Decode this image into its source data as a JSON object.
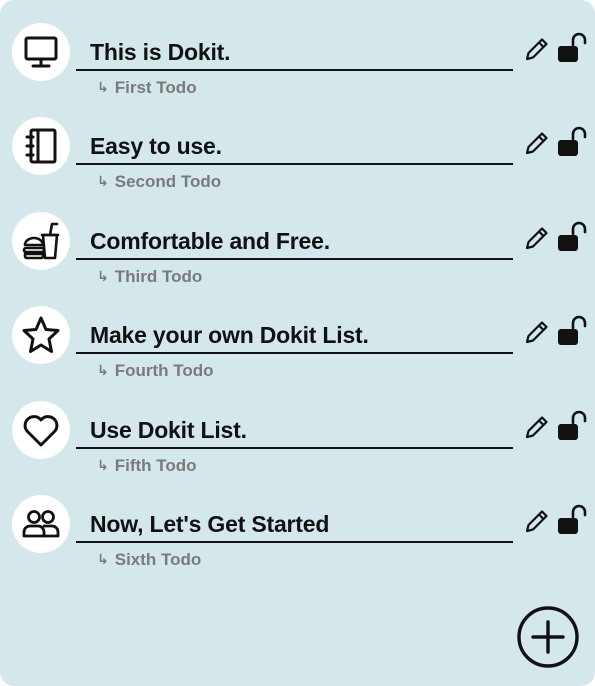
{
  "todos": [
    {
      "icon": "monitor-icon",
      "title": "This is Dokit.",
      "subtitle": "First Todo"
    },
    {
      "icon": "notebook-icon",
      "title": "Easy to use.",
      "subtitle": "Second Todo"
    },
    {
      "icon": "fast-food-icon",
      "title": "Comfortable and Free.",
      "subtitle": "Third Todo"
    },
    {
      "icon": "star-icon",
      "title": "Make your own Dokit List.",
      "subtitle": "Fourth Todo"
    },
    {
      "icon": "heart-icon",
      "title": "Use Dokit List.",
      "subtitle": "Fifth Todo"
    },
    {
      "icon": "users-icon",
      "title": "Now, Let's Get Started",
      "subtitle": "Sixth Todo"
    }
  ],
  "actions": {
    "edit_icon": "pencil-icon",
    "lock_icon": "unlock-icon",
    "add_icon": "plus-circle-icon"
  },
  "colors": {
    "background": "#d4e8ec",
    "icon_circle": "#ffffff",
    "text": "#111111",
    "subtitle": "#7a7a7a"
  }
}
